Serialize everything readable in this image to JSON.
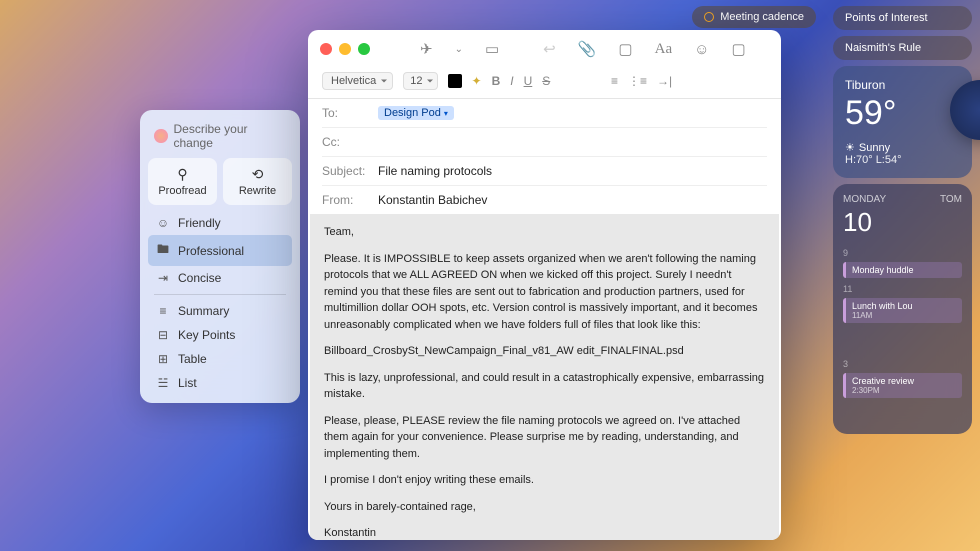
{
  "meeting_pill": "Meeting cadence",
  "right_pills": [
    "Points of Interest",
    "Naismith's Rule"
  ],
  "ai": {
    "header": "Describe your change",
    "buttons": [
      {
        "icon": "⚲",
        "label": "Proofread"
      },
      {
        "icon": "⟲",
        "label": "Rewrite"
      }
    ],
    "tones": [
      {
        "icon": "☺",
        "label": "Friendly",
        "selected": false
      },
      {
        "icon": "🖿",
        "label": "Professional",
        "selected": true
      },
      {
        "icon": "⇥",
        "label": "Concise",
        "selected": false
      }
    ],
    "formats": [
      {
        "icon": "≡",
        "label": "Summary"
      },
      {
        "icon": "⊟",
        "label": "Key Points"
      },
      {
        "icon": "⊞",
        "label": "Table"
      },
      {
        "icon": "☱",
        "label": "List"
      }
    ]
  },
  "mail": {
    "format": {
      "font": "Helvetica",
      "size": "12"
    },
    "headers": {
      "to_label": "To:",
      "to_token": "Design Pod",
      "cc_label": "Cc:",
      "subject_label": "Subject:",
      "subject": "File naming protocols",
      "from_label": "From:",
      "from": "Konstantin Babichev"
    },
    "body": {
      "greeting": "Team,",
      "p1": "Please. It is IMPOSSIBLE to keep assets organized when we aren't following the naming protocols that we ALL AGREED ON when we kicked off this project. Surely I needn't remind you that these files are sent out to fabrication and production partners, used for multimillion dollar OOH spots, etc. Version control is massively important, and it becomes unreasonably complicated when we have folders full of files that look like this:",
      "filename": "Billboard_CrosbySt_NewCampaign_Final_v81_AW edit_FINALFINAL.psd",
      "p2": "This is lazy, unprofessional, and could result in a catastrophically expensive, embarrassing mistake.",
      "p3": "Please, please, PLEASE review the file naming protocols we agreed on. I've attached them again for your convenience. Please surprise me by reading, understanding, and implementing them.",
      "p4": "I promise I don't enjoy writing these emails.",
      "closing": "Yours in barely-contained rage,",
      "sig": "Konstantin"
    }
  },
  "weather": {
    "location": "Tiburon",
    "temp": "59°",
    "condition": "Sunny",
    "hilo": "H:70° L:54°"
  },
  "calendar": {
    "day_label": "MONDAY",
    "tom_label": "TOM",
    "date": "10",
    "events": [
      {
        "title": "Monday huddle",
        "time": ""
      },
      {
        "title": "Lunch with Lou",
        "time": "11AM"
      },
      {
        "title": "Creative review",
        "time": "2:30PM"
      }
    ],
    "hours": [
      "9",
      "11",
      "3"
    ]
  }
}
